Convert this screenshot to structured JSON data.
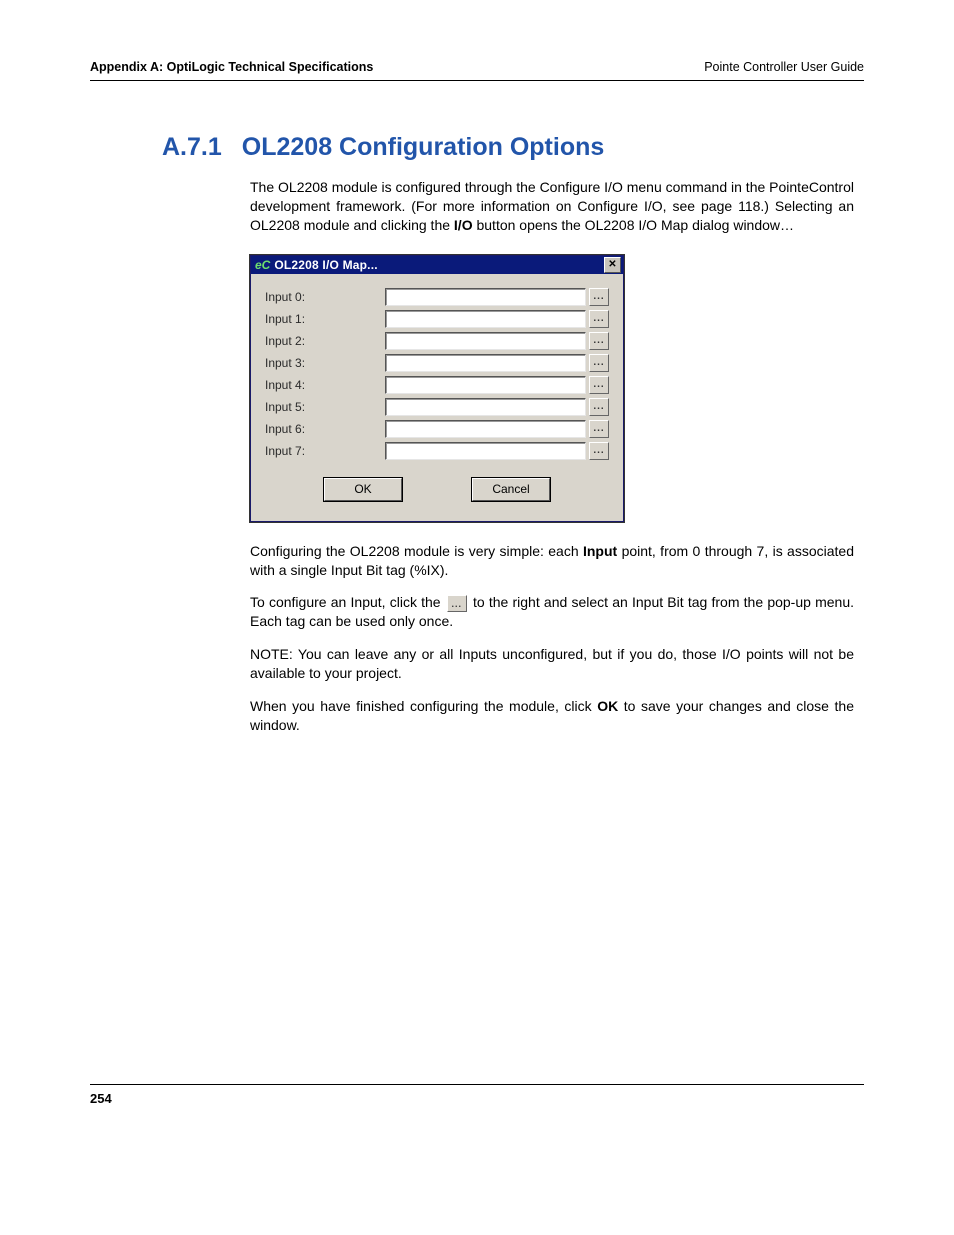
{
  "header": {
    "left": "Appendix A: OptiLogic Technical Specifications",
    "right": "Pointe Controller User Guide"
  },
  "section": {
    "number": "A.7.1",
    "title": "OL2208 Configuration Options"
  },
  "paragraphs": {
    "p1_a": "The OL2208 module is configured through the Configure I/O menu command in the PointeControl development framework. (For more information on Configure I/O, see page 118.) Selecting an OL2208 module and clicking the ",
    "p1_bold": "I/O",
    "p1_b": " button opens the OL2208 I/O Map dialog window…",
    "p2_a": "Configuring the OL2208 module is very simple: each ",
    "p2_bold": "Input",
    "p2_b": " point, from 0 through 7, is associated with a single Input Bit tag (%IX).",
    "p3_a": "To configure an Input, click the ",
    "p3_b": " to the right and select an Input Bit tag from the pop-up menu. Each tag can be used only once.",
    "p4": "NOTE: You can leave any or all Inputs unconfigured, but if you do, those I/O points will not be available to your project.",
    "p5_a": "When you have finished configuring the module, click ",
    "p5_bold": "OK",
    "p5_b": " to save your changes and close the window."
  },
  "dialog": {
    "logo": "eC",
    "title": "OL2208 I/O Map...",
    "rows": [
      {
        "label": "Input 0:"
      },
      {
        "label": "Input 1:"
      },
      {
        "label": "Input 2:"
      },
      {
        "label": "Input 3:"
      },
      {
        "label": "Input 4:"
      },
      {
        "label": "Input 5:"
      },
      {
        "label": "Input 6:"
      },
      {
        "label": "Input 7:"
      }
    ],
    "ok": "OK",
    "cancel": "Cancel",
    "ellipsis": "..."
  },
  "page_number": "254"
}
